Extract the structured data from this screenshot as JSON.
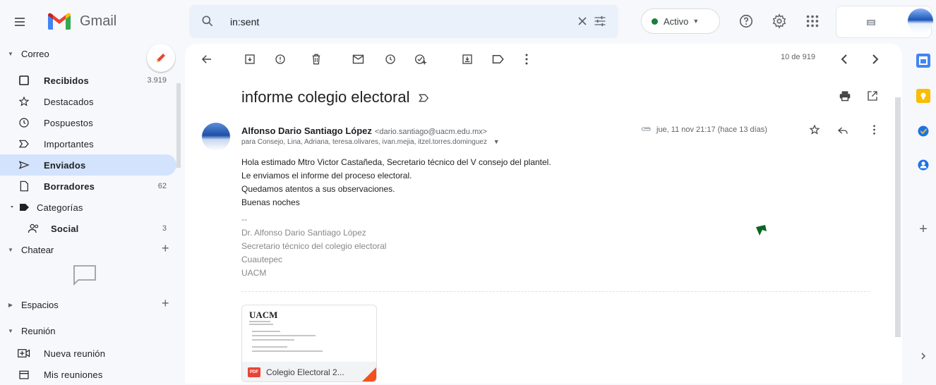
{
  "header": {
    "app_name": "Gmail",
    "search": {
      "value": "in:sent"
    },
    "status": {
      "label": "Activo"
    }
  },
  "sidebar": {
    "mail_section": "Correo",
    "items": [
      {
        "label": "Recibidos",
        "count": "3.919",
        "bold": true,
        "icon": "inbox-icon"
      },
      {
        "label": "Destacados",
        "count": "",
        "bold": false,
        "icon": "star-icon"
      },
      {
        "label": "Pospuestos",
        "count": "",
        "bold": false,
        "icon": "clock-icon"
      },
      {
        "label": "Importantes",
        "count": "",
        "bold": false,
        "icon": "important-icon"
      },
      {
        "label": "Enviados",
        "count": "",
        "bold": true,
        "icon": "send-icon",
        "active": true
      },
      {
        "label": "Borradores",
        "count": "62",
        "bold": true,
        "icon": "draft-icon"
      },
      {
        "label": "Categorías",
        "count": "",
        "bold": false,
        "icon": "label-icon"
      },
      {
        "label": "Social",
        "count": "3",
        "bold": true,
        "icon": "people-icon"
      }
    ],
    "chat_section": "Chatear",
    "spaces_section": "Espacios",
    "meet_section": "Reunión",
    "meet_items": [
      {
        "label": "Nueva reunión",
        "icon": "video-add-icon"
      },
      {
        "label": "Mis reuniones",
        "icon": "calendar-icon"
      }
    ]
  },
  "toolbar": {
    "pager": "10 de 919"
  },
  "email": {
    "subject": "informe colegio electoral",
    "sender_name": "Alfonso Dario Santiago López",
    "sender_email": "<dario.santiago@uacm.edu.mx>",
    "recipients": "para Consejo, Lina, Adriana, teresa.olivares, ivan.mejia, itzel.torres.dominguez",
    "date": "jue, 11 nov 21:17 (hace 13 días)",
    "body": [
      "Hola estimado Mtro Victor Castañeda, Secretario técnico del V consejo del plantel.",
      "Le enviamos el informe del proceso electoral.",
      "Quedamos atentos a sus observaciones.",
      "Buenas noches"
    ],
    "signature": [
      "--",
      "Dr. Alfonso Dario Santiago López",
      "Secretario técnico del colegio electoral",
      "Cuautepec",
      "UACM"
    ],
    "attachment": {
      "brand": "UACM",
      "name": "Colegio Electoral 2...",
      "type": "PDF"
    }
  },
  "colors": {
    "active_nav": "#d3e3fd",
    "status_green": "#188038",
    "pdf_red": "#ea4335"
  }
}
